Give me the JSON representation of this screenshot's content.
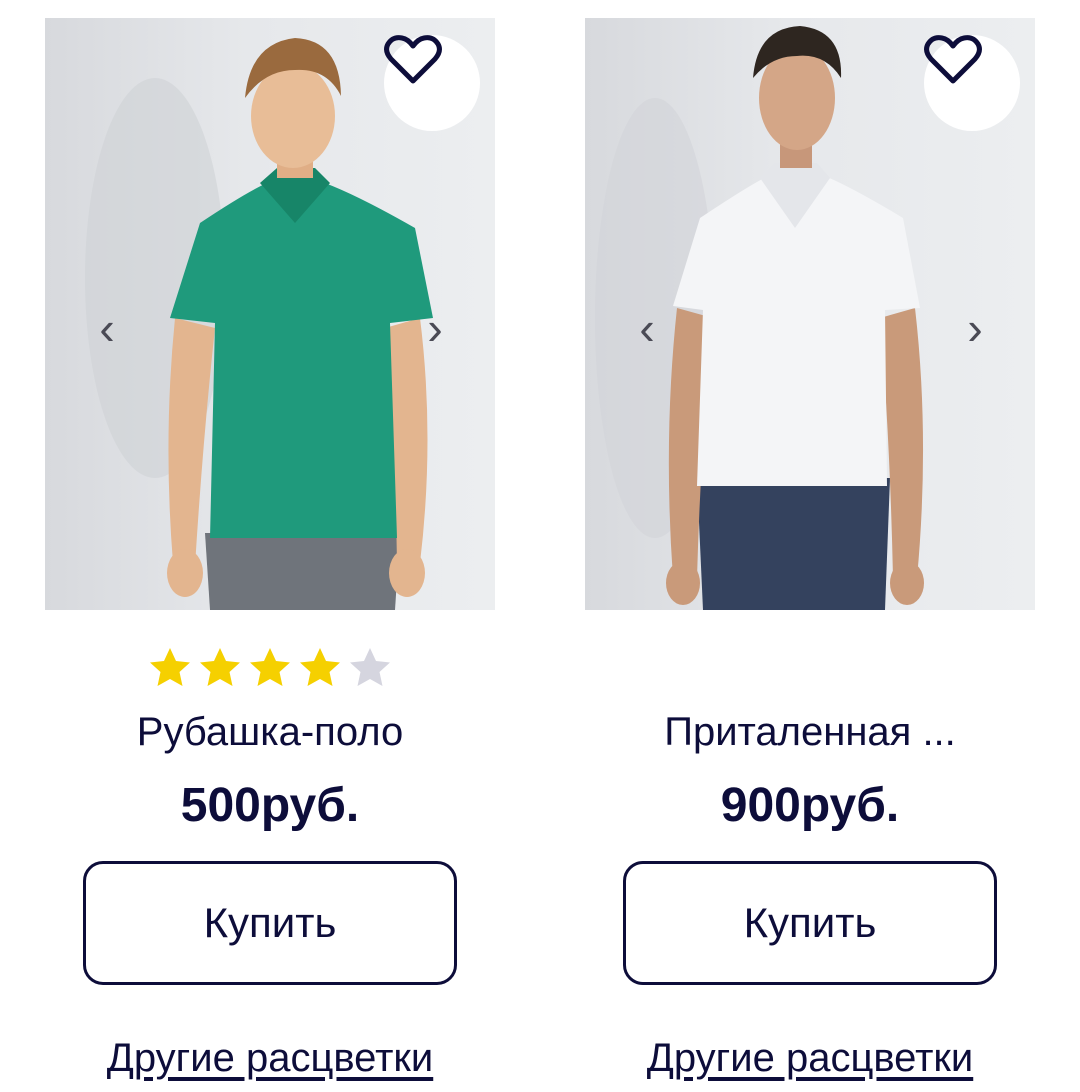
{
  "products": [
    {
      "title": "Рубашка-поло",
      "price": "500руб.",
      "rating": 4,
      "rating_max": 5,
      "buy_label": "Купить",
      "colors_link": "Другие расцветки",
      "shirt_color": "#1f9a7c",
      "pants_color": "#6f747b",
      "icons": {
        "favorite": "heart-outline-icon",
        "prev": "chevron-left-icon",
        "next": "chevron-right-icon"
      }
    },
    {
      "title": "Приталенная ...",
      "price": "900руб.",
      "buy_label": "Купить",
      "colors_link": "Другие расцветки",
      "shirt_color": "#f4f5f7",
      "pants_color": "#34425e",
      "icons": {
        "favorite": "heart-outline-icon",
        "prev": "chevron-left-icon",
        "next": "chevron-right-icon"
      }
    }
  ],
  "colors": {
    "text": "#0d0d3a",
    "star_filled": "#f5d000",
    "star_empty": "#d5d5df",
    "button_border": "#0d0d3a"
  },
  "glyphs": {
    "prev": "‹",
    "next": "›"
  }
}
